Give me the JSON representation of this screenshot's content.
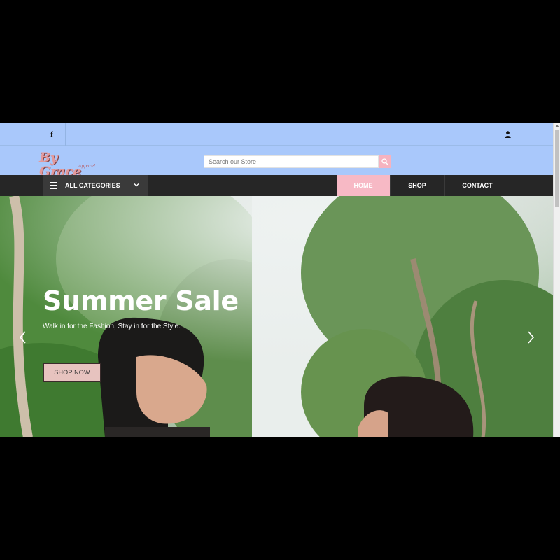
{
  "topbar": {
    "facebook_icon": "facebook-icon",
    "account_icon": "user-icon"
  },
  "header": {
    "logo_text": "By Grace",
    "logo_subtext": "Apparel",
    "search_placeholder": "Search our Store",
    "search_icon": "search-icon"
  },
  "nav": {
    "categories_label": "ALL CATEGORIES",
    "items": [
      {
        "label": "HOME"
      },
      {
        "label": "SHOP"
      },
      {
        "label": "CONTACT"
      }
    ]
  },
  "hero": {
    "title": "Summer Sale",
    "subtitle": "Walk in for the Fashion, Stay in for the Style.",
    "button_label": "SHOP NOW"
  },
  "colors": {
    "header_bg": "#a9c8fb",
    "nav_bg": "#262626",
    "accent_pink": "#f7b9c5"
  }
}
